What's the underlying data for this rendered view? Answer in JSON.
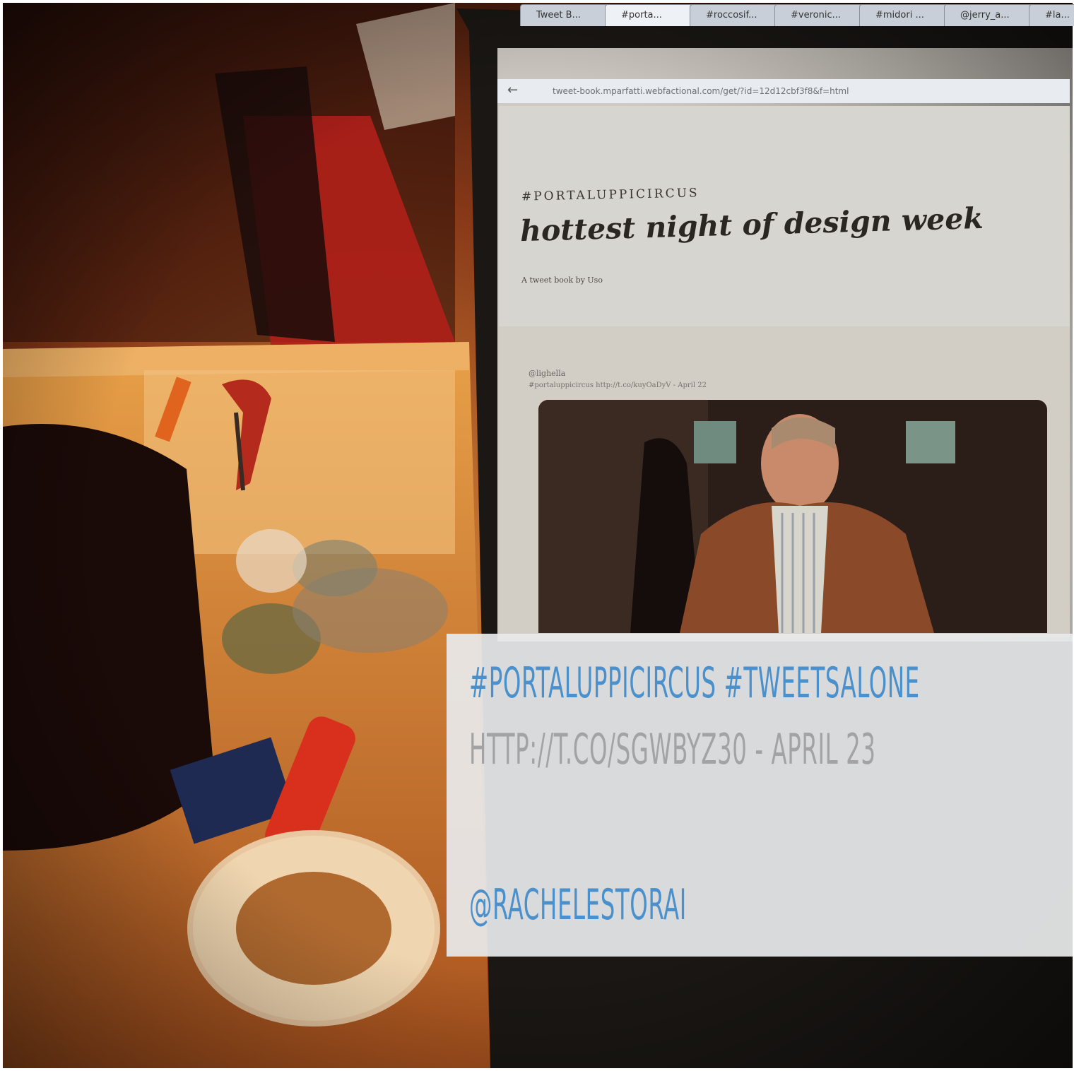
{
  "browser": {
    "tabs": [
      "Tweet B...",
      "#porta...",
      "#roccosif...",
      "#veronic...",
      "#midori ...",
      "@jerry_a...",
      "#la..."
    ],
    "url": "tweet-book.mparfatti.webfactional.com/get/?id=12d12cbf3f8&f=html"
  },
  "page": {
    "kicker": "#PORTALUPPICIRCUS",
    "title": "hottest night of design week",
    "byline": "A tweet book by Uso",
    "tweet_user": "@lighella",
    "tweet_text": "#portaluppicircus http://t.co/kuyOaDyV - April 22"
  },
  "caption": {
    "hashtags": "#PORTALUPPICIRCUS #TWEETSALONE",
    "link": "HTTP://T.CO/SGWBYZ30 - APRIL 23",
    "user": "@RACHELESTORAI"
  },
  "colors": {
    "accent_blue": "#4a90cc",
    "muted_gray": "#a3a3a5",
    "overlay_bg": "#e8e9eb"
  }
}
